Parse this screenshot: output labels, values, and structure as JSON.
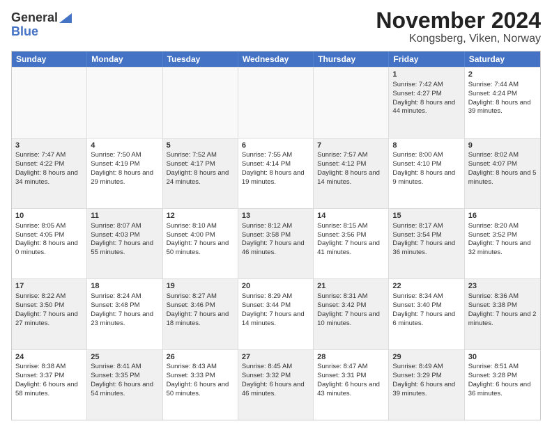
{
  "header": {
    "logo_general": "General",
    "logo_blue": "Blue",
    "title": "November 2024",
    "subtitle": "Kongsberg, Viken, Norway"
  },
  "weekdays": [
    "Sunday",
    "Monday",
    "Tuesday",
    "Wednesday",
    "Thursday",
    "Friday",
    "Saturday"
  ],
  "rows": [
    [
      {
        "day": "",
        "sunrise": "",
        "sunset": "",
        "daylight": "",
        "empty": true
      },
      {
        "day": "",
        "sunrise": "",
        "sunset": "",
        "daylight": "",
        "empty": true
      },
      {
        "day": "",
        "sunrise": "",
        "sunset": "",
        "daylight": "",
        "empty": true
      },
      {
        "day": "",
        "sunrise": "",
        "sunset": "",
        "daylight": "",
        "empty": true
      },
      {
        "day": "",
        "sunrise": "",
        "sunset": "",
        "daylight": "",
        "empty": true
      },
      {
        "day": "1",
        "sunrise": "Sunrise: 7:42 AM",
        "sunset": "Sunset: 4:27 PM",
        "daylight": "Daylight: 8 hours and 44 minutes.",
        "empty": false,
        "shaded": true
      },
      {
        "day": "2",
        "sunrise": "Sunrise: 7:44 AM",
        "sunset": "Sunset: 4:24 PM",
        "daylight": "Daylight: 8 hours and 39 minutes.",
        "empty": false,
        "shaded": false
      }
    ],
    [
      {
        "day": "3",
        "sunrise": "Sunrise: 7:47 AM",
        "sunset": "Sunset: 4:22 PM",
        "daylight": "Daylight: 8 hours and 34 minutes.",
        "empty": false,
        "shaded": true
      },
      {
        "day": "4",
        "sunrise": "Sunrise: 7:50 AM",
        "sunset": "Sunset: 4:19 PM",
        "daylight": "Daylight: 8 hours and 29 minutes.",
        "empty": false,
        "shaded": false
      },
      {
        "day": "5",
        "sunrise": "Sunrise: 7:52 AM",
        "sunset": "Sunset: 4:17 PM",
        "daylight": "Daylight: 8 hours and 24 minutes.",
        "empty": false,
        "shaded": true
      },
      {
        "day": "6",
        "sunrise": "Sunrise: 7:55 AM",
        "sunset": "Sunset: 4:14 PM",
        "daylight": "Daylight: 8 hours and 19 minutes.",
        "empty": false,
        "shaded": false
      },
      {
        "day": "7",
        "sunrise": "Sunrise: 7:57 AM",
        "sunset": "Sunset: 4:12 PM",
        "daylight": "Daylight: 8 hours and 14 minutes.",
        "empty": false,
        "shaded": true
      },
      {
        "day": "8",
        "sunrise": "Sunrise: 8:00 AM",
        "sunset": "Sunset: 4:10 PM",
        "daylight": "Daylight: 8 hours and 9 minutes.",
        "empty": false,
        "shaded": false
      },
      {
        "day": "9",
        "sunrise": "Sunrise: 8:02 AM",
        "sunset": "Sunset: 4:07 PM",
        "daylight": "Daylight: 8 hours and 5 minutes.",
        "empty": false,
        "shaded": true
      }
    ],
    [
      {
        "day": "10",
        "sunrise": "Sunrise: 8:05 AM",
        "sunset": "Sunset: 4:05 PM",
        "daylight": "Daylight: 8 hours and 0 minutes.",
        "empty": false,
        "shaded": false
      },
      {
        "day": "11",
        "sunrise": "Sunrise: 8:07 AM",
        "sunset": "Sunset: 4:03 PM",
        "daylight": "Daylight: 7 hours and 55 minutes.",
        "empty": false,
        "shaded": true
      },
      {
        "day": "12",
        "sunrise": "Sunrise: 8:10 AM",
        "sunset": "Sunset: 4:00 PM",
        "daylight": "Daylight: 7 hours and 50 minutes.",
        "empty": false,
        "shaded": false
      },
      {
        "day": "13",
        "sunrise": "Sunrise: 8:12 AM",
        "sunset": "Sunset: 3:58 PM",
        "daylight": "Daylight: 7 hours and 46 minutes.",
        "empty": false,
        "shaded": true
      },
      {
        "day": "14",
        "sunrise": "Sunrise: 8:15 AM",
        "sunset": "Sunset: 3:56 PM",
        "daylight": "Daylight: 7 hours and 41 minutes.",
        "empty": false,
        "shaded": false
      },
      {
        "day": "15",
        "sunrise": "Sunrise: 8:17 AM",
        "sunset": "Sunset: 3:54 PM",
        "daylight": "Daylight: 7 hours and 36 minutes.",
        "empty": false,
        "shaded": true
      },
      {
        "day": "16",
        "sunrise": "Sunrise: 8:20 AM",
        "sunset": "Sunset: 3:52 PM",
        "daylight": "Daylight: 7 hours and 32 minutes.",
        "empty": false,
        "shaded": false
      }
    ],
    [
      {
        "day": "17",
        "sunrise": "Sunrise: 8:22 AM",
        "sunset": "Sunset: 3:50 PM",
        "daylight": "Daylight: 7 hours and 27 minutes.",
        "empty": false,
        "shaded": true
      },
      {
        "day": "18",
        "sunrise": "Sunrise: 8:24 AM",
        "sunset": "Sunset: 3:48 PM",
        "daylight": "Daylight: 7 hours and 23 minutes.",
        "empty": false,
        "shaded": false
      },
      {
        "day": "19",
        "sunrise": "Sunrise: 8:27 AM",
        "sunset": "Sunset: 3:46 PM",
        "daylight": "Daylight: 7 hours and 18 minutes.",
        "empty": false,
        "shaded": true
      },
      {
        "day": "20",
        "sunrise": "Sunrise: 8:29 AM",
        "sunset": "Sunset: 3:44 PM",
        "daylight": "Daylight: 7 hours and 14 minutes.",
        "empty": false,
        "shaded": false
      },
      {
        "day": "21",
        "sunrise": "Sunrise: 8:31 AM",
        "sunset": "Sunset: 3:42 PM",
        "daylight": "Daylight: 7 hours and 10 minutes.",
        "empty": false,
        "shaded": true
      },
      {
        "day": "22",
        "sunrise": "Sunrise: 8:34 AM",
        "sunset": "Sunset: 3:40 PM",
        "daylight": "Daylight: 7 hours and 6 minutes.",
        "empty": false,
        "shaded": false
      },
      {
        "day": "23",
        "sunrise": "Sunrise: 8:36 AM",
        "sunset": "Sunset: 3:38 PM",
        "daylight": "Daylight: 7 hours and 2 minutes.",
        "empty": false,
        "shaded": true
      }
    ],
    [
      {
        "day": "24",
        "sunrise": "Sunrise: 8:38 AM",
        "sunset": "Sunset: 3:37 PM",
        "daylight": "Daylight: 6 hours and 58 minutes.",
        "empty": false,
        "shaded": false
      },
      {
        "day": "25",
        "sunrise": "Sunrise: 8:41 AM",
        "sunset": "Sunset: 3:35 PM",
        "daylight": "Daylight: 6 hours and 54 minutes.",
        "empty": false,
        "shaded": true
      },
      {
        "day": "26",
        "sunrise": "Sunrise: 8:43 AM",
        "sunset": "Sunset: 3:33 PM",
        "daylight": "Daylight: 6 hours and 50 minutes.",
        "empty": false,
        "shaded": false
      },
      {
        "day": "27",
        "sunrise": "Sunrise: 8:45 AM",
        "sunset": "Sunset: 3:32 PM",
        "daylight": "Daylight: 6 hours and 46 minutes.",
        "empty": false,
        "shaded": true
      },
      {
        "day": "28",
        "sunrise": "Sunrise: 8:47 AM",
        "sunset": "Sunset: 3:31 PM",
        "daylight": "Daylight: 6 hours and 43 minutes.",
        "empty": false,
        "shaded": false
      },
      {
        "day": "29",
        "sunrise": "Sunrise: 8:49 AM",
        "sunset": "Sunset: 3:29 PM",
        "daylight": "Daylight: 6 hours and 39 minutes.",
        "empty": false,
        "shaded": true
      },
      {
        "day": "30",
        "sunrise": "Sunrise: 8:51 AM",
        "sunset": "Sunset: 3:28 PM",
        "daylight": "Daylight: 6 hours and 36 minutes.",
        "empty": false,
        "shaded": false
      }
    ]
  ]
}
